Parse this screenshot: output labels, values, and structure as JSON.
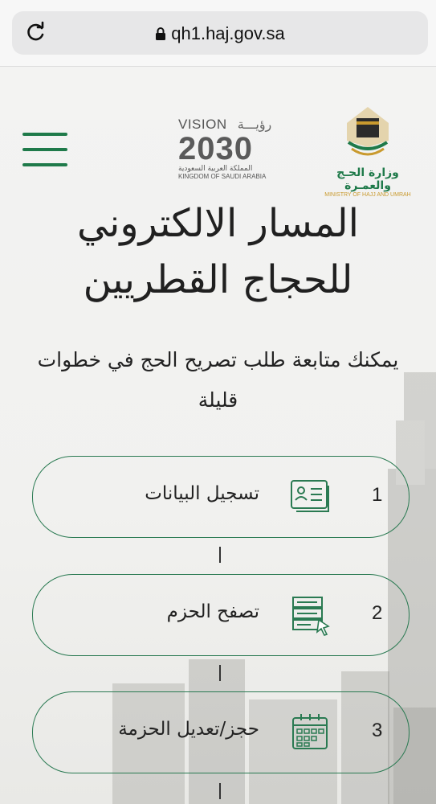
{
  "browser": {
    "url": "qh1.haj.gov.sa"
  },
  "header": {
    "vision_logo": {
      "top_en": "VISION",
      "top_ar": "رؤيـــة",
      "number": "2030",
      "sub_ar": "المملكة العربية السعودية",
      "sub_en": "KINGDOM OF SAUDI ARABIA"
    },
    "ministry_logo": {
      "name_ar": "وزارة الحـج والعمـرة",
      "name_en": "MINISTRY OF HAJJ AND UMRAH"
    }
  },
  "hero": {
    "title_line1": "المسار الالكتروني",
    "title_line2": "للحجاج القطريين",
    "subtitle": "يمكنك متابعة طلب تصريح الحج في خطوات قليلة"
  },
  "steps": [
    {
      "number": "1",
      "label": "تسجيل البيانات",
      "icon": "id-card-icon"
    },
    {
      "number": "2",
      "label": "تصفح الحزم",
      "icon": "package-list-icon"
    },
    {
      "number": "3",
      "label": "حجز/تعديل الحزمة",
      "icon": "calendar-icon"
    }
  ],
  "colors": {
    "brand_green": "#1f7a4a",
    "step_border": "#2a7a52",
    "ministry_gold": "#c99a2e"
  }
}
